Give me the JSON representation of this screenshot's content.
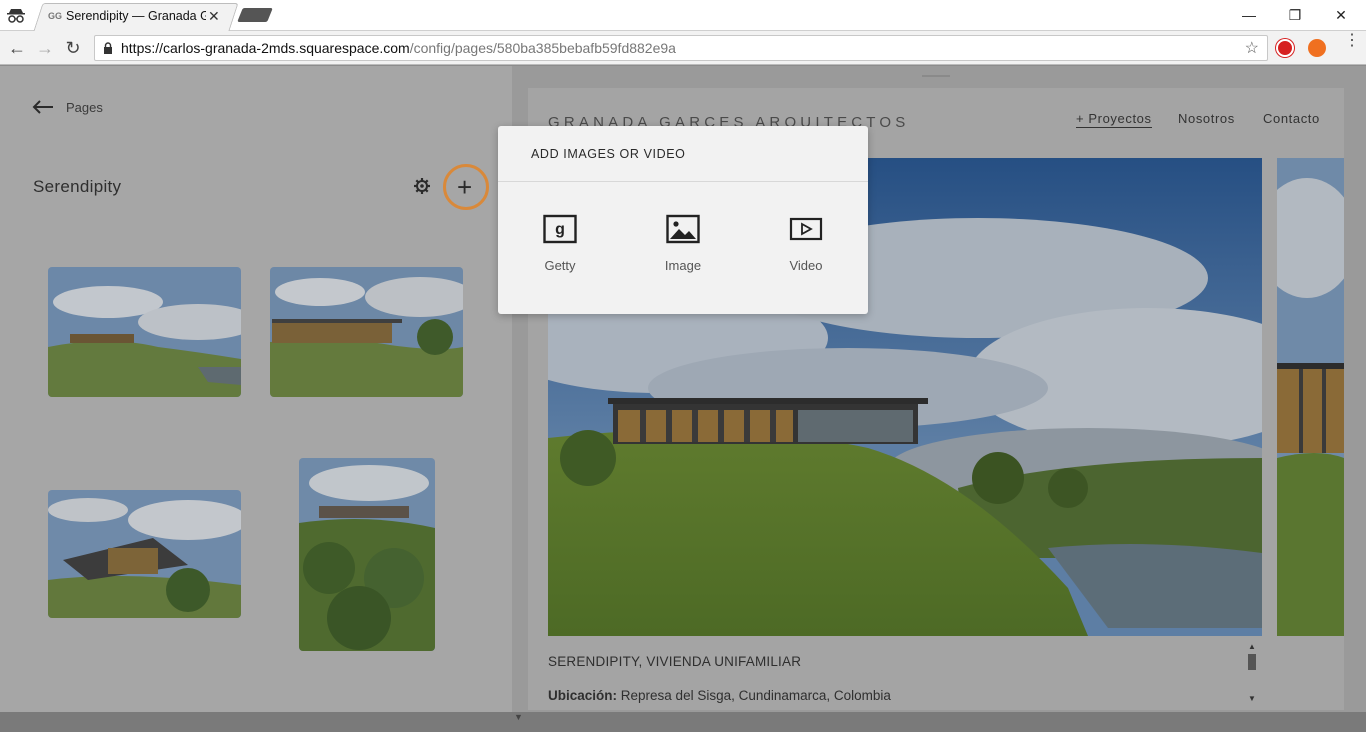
{
  "browser": {
    "tab_title": "Serendipity — Granada G",
    "favicon_text": "GG",
    "url_host": "https://carlos-granada-2mds.squarespace.com",
    "url_path": "/config/pages/580ba385bebafb59fd882e9a"
  },
  "left_panel": {
    "back_label": "Pages",
    "gallery_title": "Serendipity"
  },
  "preview": {
    "site_logo": "GRANADA GARCES ARQUITECTOS",
    "nav": [
      "+ Proyectos",
      "Nosotros",
      "Contacto"
    ],
    "caption": "SERENDIPITY, VIVIENDA UNIFAMILIAR",
    "location_label": "Ubicación:",
    "location_value": "Represa del Sisga, Cundinamarca, Colombia"
  },
  "popup": {
    "title": "ADD IMAGES OR VIDEO",
    "options": [
      {
        "label": "Getty",
        "icon": "getty-icon"
      },
      {
        "label": "Image",
        "icon": "image-icon"
      },
      {
        "label": "Video",
        "icon": "video-icon"
      }
    ]
  },
  "colors": {
    "highlight_ring": "#d9893a",
    "popup_bg": "#f2f2f2",
    "overlay": "#9a9a9a"
  }
}
